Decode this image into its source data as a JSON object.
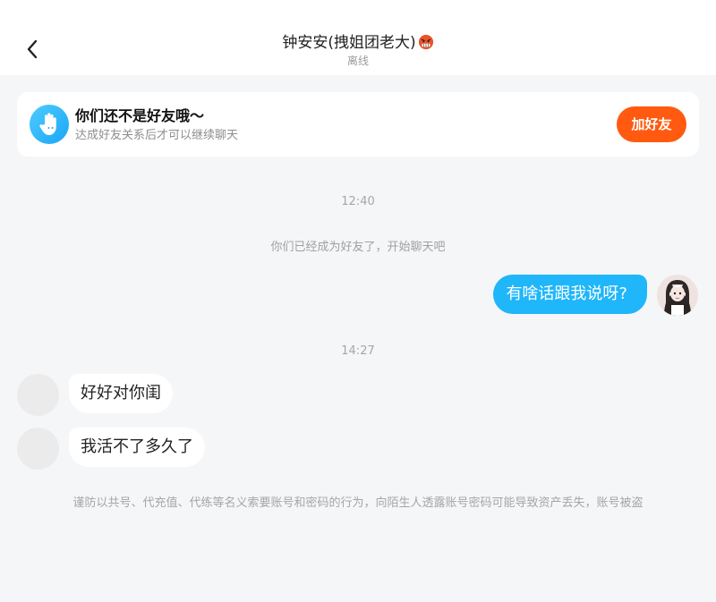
{
  "header": {
    "title": "钟安安(拽姐团老大)",
    "status": "离线"
  },
  "friend_card": {
    "title": "你们还不是好友哦～",
    "subtitle": "达成好友关系后才可以继续聊天",
    "add_button": "加好友"
  },
  "messages": {
    "time1": "12:40",
    "system": "你们已经成为好友了，开始聊天吧",
    "out1": "有啥话跟我说呀?",
    "time2": "14:27",
    "in1": "好好对你闺",
    "in2": "我活不了多久了"
  },
  "warning": "谨防以共号、代充值、代练等名义索要账号和密码的行为，向陌生人透露账号密码可能导致资产丢失，账号被盗",
  "colors": {
    "accent_orange": "#ff5a10",
    "bubble_blue": "#1fb6fa",
    "background": "#f5f6f8"
  },
  "icons": {
    "back": "chevron-left-icon",
    "title_emoji": "angry-face-icon",
    "friend_card": "waving-hand-icon"
  }
}
